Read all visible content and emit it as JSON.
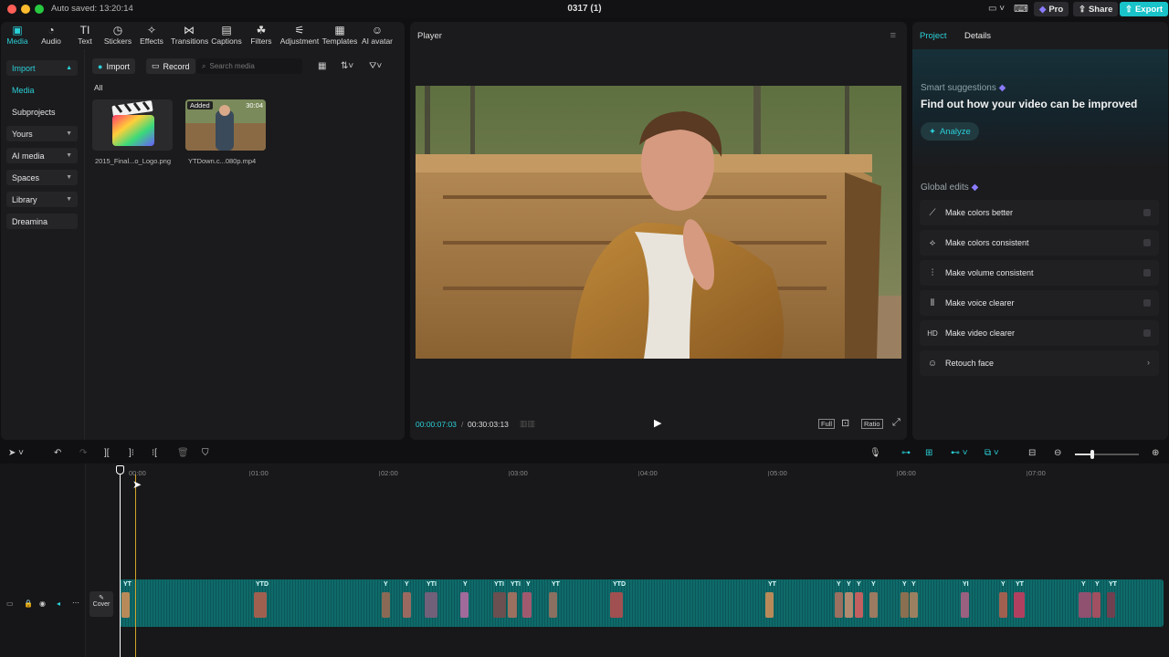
{
  "titlebar": {
    "autosave": "Auto saved: 13:20:14",
    "project_title": "0317 (1)",
    "pro_label": "Pro",
    "share_label": "Share",
    "export_label": "Export"
  },
  "toolbar": {
    "items": [
      {
        "label": "Media",
        "icon": "media-icon"
      },
      {
        "label": "Audio",
        "icon": "audio-icon"
      },
      {
        "label": "Text",
        "icon": "text-icon"
      },
      {
        "label": "Stickers",
        "icon": "stickers-icon"
      },
      {
        "label": "Effects",
        "icon": "effects-icon"
      },
      {
        "label": "Transitions",
        "icon": "transitions-icon"
      },
      {
        "label": "Captions",
        "icon": "captions-icon"
      },
      {
        "label": "Filters",
        "icon": "filters-icon"
      },
      {
        "label": "Adjustment",
        "icon": "adjustment-icon"
      },
      {
        "label": "Templates",
        "icon": "templates-icon"
      },
      {
        "label": "AI avatar",
        "icon": "ai-avatar-icon"
      }
    ]
  },
  "sidebar": {
    "items": [
      "Import",
      "Media",
      "Subprojects",
      "Yours",
      "AI media",
      "Spaces",
      "Library",
      "Dreamina"
    ]
  },
  "media": {
    "import_label": "Import",
    "record_label": "Record",
    "search_placeholder": "Search media",
    "filter_label": "All",
    "items": [
      {
        "name": "2015_Final...o_Logo.png"
      },
      {
        "name": "YTDown.c...080p.mp4",
        "badge": "Added",
        "duration": "30:04"
      }
    ]
  },
  "player": {
    "title": "Player",
    "current_time": "00:00:07:03",
    "total_time": "00:30:03:13",
    "full_label": "Full",
    "ratio_label": "Ratio"
  },
  "right_panel": {
    "tabs": [
      "Project",
      "Details"
    ],
    "smart_title": "Smart suggestions",
    "smart_headline": "Find out how your video can be improved",
    "analyze_label": "Analyze",
    "global_edits_title": "Global edits",
    "global_edits": [
      {
        "label": "Make colors better",
        "icon": "magic-wand-icon"
      },
      {
        "label": "Make colors consistent",
        "icon": "palette-icon"
      },
      {
        "label": "Make volume consistent",
        "icon": "sliders-icon"
      },
      {
        "label": "Make voice clearer",
        "icon": "waveform-icon"
      },
      {
        "label": "Make video clearer",
        "icon": "hd-icon",
        "icon_text": "HD"
      },
      {
        "label": "Retouch face",
        "icon": "face-icon"
      }
    ]
  },
  "timeline": {
    "ticks": [
      "00:00",
      "01:00",
      "02:00",
      "03:00",
      "04:00",
      "05:00",
      "06:00",
      "07:00"
    ],
    "cover_label": "Cover",
    "clip_labels": [
      "YT",
      "YTD",
      "Y",
      "Y",
      "YTI",
      "Y",
      "YTI",
      "YTI",
      "Y",
      "YT",
      "YTD",
      "YT",
      "Y",
      "Y",
      "Y",
      "Y",
      "Y",
      "Y",
      "YI",
      "Y",
      "YT",
      "Y",
      "Y",
      "YT"
    ]
  },
  "colors": {
    "accent": "#2ad0d8",
    "track": "#0f6a6a",
    "playhead": "#ffffff",
    "marker": "#d4a52a"
  }
}
